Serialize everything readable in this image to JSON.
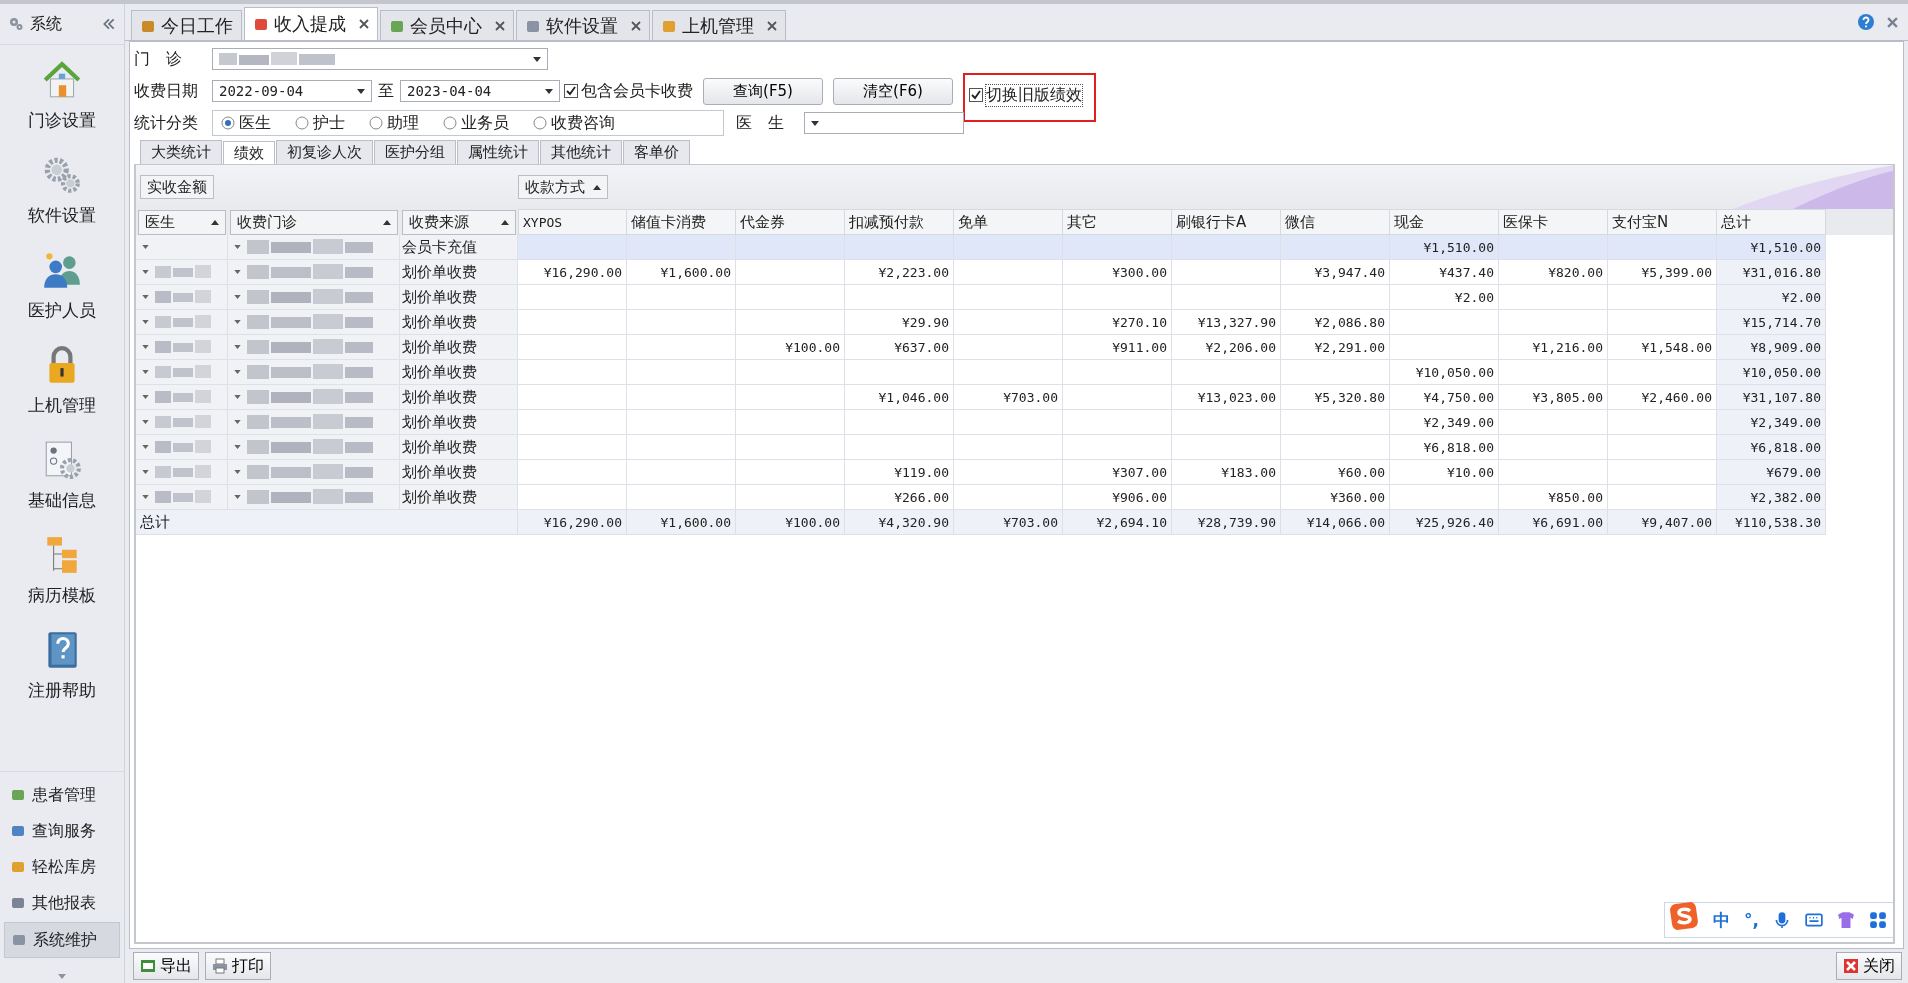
{
  "sidebar": {
    "title": "系统",
    "large_items": [
      {
        "label": "门诊设置"
      },
      {
        "label": "软件设置"
      },
      {
        "label": "医护人员"
      },
      {
        "label": "上机管理"
      },
      {
        "label": "基础信息"
      },
      {
        "label": "病历模板"
      },
      {
        "label": "注册帮助"
      }
    ],
    "small_items": [
      {
        "label": "患者管理",
        "selected": false
      },
      {
        "label": "查询服务",
        "selected": false
      },
      {
        "label": "轻松库房",
        "selected": false
      },
      {
        "label": "其他报表",
        "selected": false
      },
      {
        "label": "系统维护",
        "selected": true
      }
    ]
  },
  "tabs": [
    {
      "label": "今日工作",
      "selected": false,
      "closable": false
    },
    {
      "label": "收入提成",
      "selected": true,
      "closable": true
    },
    {
      "label": "会员中心",
      "selected": false,
      "closable": true
    },
    {
      "label": "软件设置",
      "selected": false,
      "closable": true
    },
    {
      "label": "上机管理",
      "selected": false,
      "closable": true
    }
  ],
  "filters": {
    "clinic_label": "门　诊",
    "date_label": "收费日期",
    "date_from": "2022-09-04",
    "to_label": "至",
    "date_to": "2023-04-04",
    "include_member": {
      "label": "包含会员卡收费",
      "checked": true
    },
    "query_button": "查询(F5)",
    "clear_button": "清空(F6)",
    "old_version": {
      "label": "切换旧版绩效",
      "checked": true,
      "highlighted": true
    },
    "category_label": "统计分类",
    "categories": [
      {
        "label": "医生",
        "selected": true
      },
      {
        "label": "护士",
        "selected": false
      },
      {
        "label": "助理",
        "selected": false
      },
      {
        "label": "业务员",
        "selected": false
      },
      {
        "label": "收费咨询",
        "selected": false
      }
    ],
    "doctor_label": "医　生"
  },
  "sub_tabs": [
    {
      "label": "大类统计",
      "selected": false
    },
    {
      "label": "绩效",
      "selected": true
    },
    {
      "label": "初复诊人次",
      "selected": false
    },
    {
      "label": "医护分组",
      "selected": false
    },
    {
      "label": "属性统计",
      "selected": false
    },
    {
      "label": "其他统计",
      "selected": false
    },
    {
      "label": "客单价",
      "selected": false
    }
  ],
  "grid": {
    "data_field": "实收金额",
    "column_field": "收款方式",
    "row_fields": [
      "医生",
      "收费门诊",
      "收费来源"
    ],
    "columns": [
      "XYPOS",
      "储值卡消费",
      "代金券",
      "扣减预付款",
      "免单",
      "其它",
      "刷银行卡A",
      "微信",
      "现金",
      "医保卡",
      "支付宝N",
      "总计"
    ],
    "rows": [
      {
        "selected": true,
        "doctor_blurred": false,
        "source": "会员卡充值",
        "values": {
          "cash": "¥1,510.00",
          "total": "¥1,510.00"
        }
      },
      {
        "selected": false,
        "doctor_blurred": true,
        "source": "划价单收费",
        "values": {
          "xypos": "¥16,290.00",
          "stored_card": "¥1,600.00",
          "prepaid": "¥2,223.00",
          "other": "¥300.00",
          "wechat": "¥3,947.40",
          "cash": "¥437.40",
          "insurance": "¥820.00",
          "alipay": "¥5,399.00",
          "total": "¥31,016.80"
        }
      },
      {
        "selected": false,
        "doctor_blurred": true,
        "source": "划价单收费",
        "values": {
          "cash": "¥2.00",
          "total": "¥2.00"
        }
      },
      {
        "selected": false,
        "doctor_blurred": true,
        "source": "划价单收费",
        "values": {
          "prepaid": "¥29.90",
          "other": "¥270.10",
          "bank_card": "¥13,327.90",
          "wechat": "¥2,086.80",
          "total": "¥15,714.70"
        }
      },
      {
        "selected": false,
        "doctor_blurred": true,
        "source": "划价单收费",
        "values": {
          "voucher": "¥100.00",
          "prepaid": "¥637.00",
          "other": "¥911.00",
          "bank_card": "¥2,206.00",
          "wechat": "¥2,291.00",
          "insurance": "¥1,216.00",
          "alipay": "¥1,548.00",
          "total": "¥8,909.00"
        }
      },
      {
        "selected": false,
        "doctor_blurred": true,
        "source": "划价单收费",
        "values": {
          "cash": "¥10,050.00",
          "total": "¥10,050.00"
        }
      },
      {
        "selected": false,
        "doctor_blurred": true,
        "source": "划价单收费",
        "values": {
          "prepaid": "¥1,046.00",
          "waiver": "¥703.00",
          "bank_card": "¥13,023.00",
          "wechat": "¥5,320.80",
          "cash": "¥4,750.00",
          "insurance": "¥3,805.00",
          "alipay": "¥2,460.00",
          "total": "¥31,107.80"
        }
      },
      {
        "selected": false,
        "doctor_blurred": true,
        "source": "划价单收费",
        "values": {
          "cash": "¥2,349.00",
          "total": "¥2,349.00"
        }
      },
      {
        "selected": false,
        "doctor_blurred": true,
        "source": "划价单收费",
        "values": {
          "cash": "¥6,818.00",
          "total": "¥6,818.00"
        }
      },
      {
        "selected": false,
        "doctor_blurred": true,
        "source": "划价单收费",
        "values": {
          "prepaid": "¥119.00",
          "other": "¥307.00",
          "bank_card": "¥183.00",
          "wechat": "¥60.00",
          "cash": "¥10.00",
          "total": "¥679.00"
        }
      },
      {
        "selected": false,
        "doctor_blurred": true,
        "source": "划价单收费",
        "values": {
          "prepaid": "¥266.00",
          "other": "¥906.00",
          "wechat": "¥360.00",
          "insurance": "¥850.00",
          "total": "¥2,382.00"
        }
      }
    ],
    "totals": {
      "label": "总计",
      "values": [
        "¥16,290.00",
        "¥1,600.00",
        "¥100.00",
        "¥4,320.90",
        "¥703.00",
        "¥2,694.10",
        "¥28,739.90",
        "¥14,066.00",
        "¥25,926.40",
        "¥6,691.00",
        "¥9,407.00",
        "¥110,538.30"
      ]
    }
  },
  "bottom": {
    "export_button": "导出",
    "print_button": "打印",
    "close_button": "关闭"
  },
  "ime_bar": {
    "mode": "中",
    "punct": "°,"
  }
}
